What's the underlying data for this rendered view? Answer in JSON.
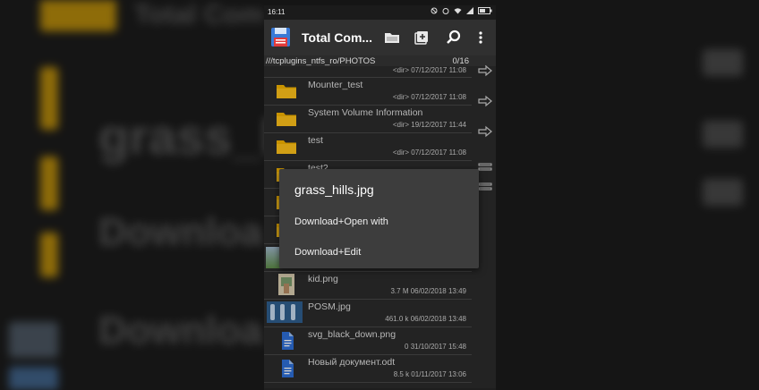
{
  "background": {
    "big_text_1": "grass_hi",
    "big_text_2": "Downloa",
    "big_text_3": "Downloa",
    "top_text": "Total Com"
  },
  "status_bar": {
    "time": "16:11"
  },
  "app_bar": {
    "title": "Total Com...",
    "icons": [
      "floppy-disk-icon",
      "folder-icon",
      "bookmark-add-icon",
      "search-icon",
      "more-vert-icon"
    ]
  },
  "path_bar": {
    "path": "///tcplugins_ntfs_ro/PHOTOS",
    "count": "0/16"
  },
  "first_row": {
    "info": "<dir> 07/12/2017  11:08"
  },
  "files": [
    {
      "name": "Mounter_test",
      "info": "<dir> 07/12/2017  11:08",
      "icon": "folder-icon"
    },
    {
      "name": "System Volume Information",
      "info": "<dir> 19/12/2017  11:44",
      "icon": "folder-icon"
    },
    {
      "name": "test",
      "info": "<dir> 07/12/2017  11:08",
      "icon": "folder-icon"
    },
    {
      "name": "test2",
      "info": "",
      "icon": "folder-icon"
    },
    {
      "name": "",
      "info": "",
      "icon": "folder-icon"
    },
    {
      "name": "",
      "info": "",
      "icon": "folder-icon"
    },
    {
      "name": "",
      "info": "",
      "icon": "folder-icon"
    },
    {
      "name": "kid.png",
      "info": "3.7 M  06/02/2018  13:49",
      "icon": "image-thumbnail"
    },
    {
      "name": "POSM.jpg",
      "info": "461.0 k  06/02/2018  13:48",
      "icon": "image-thumbnail"
    },
    {
      "name": "svg_black_down.png",
      "info": "0  31/10/2017  15:48",
      "icon": "document-icon"
    },
    {
      "name": "Новый документ.odt",
      "info": "8.5 k  01/11/2017  13:06",
      "icon": "document-icon"
    }
  ],
  "dialog": {
    "title": "grass_hills.jpg",
    "options": [
      "Download+Open with",
      "Download+Edit"
    ]
  },
  "colors": {
    "folder": "#f5b400",
    "appbar": "#303030",
    "list_bg": "#2b2b2b",
    "dialog_bg": "#3d3d3d",
    "doc_icon": "#2e6fd8"
  }
}
